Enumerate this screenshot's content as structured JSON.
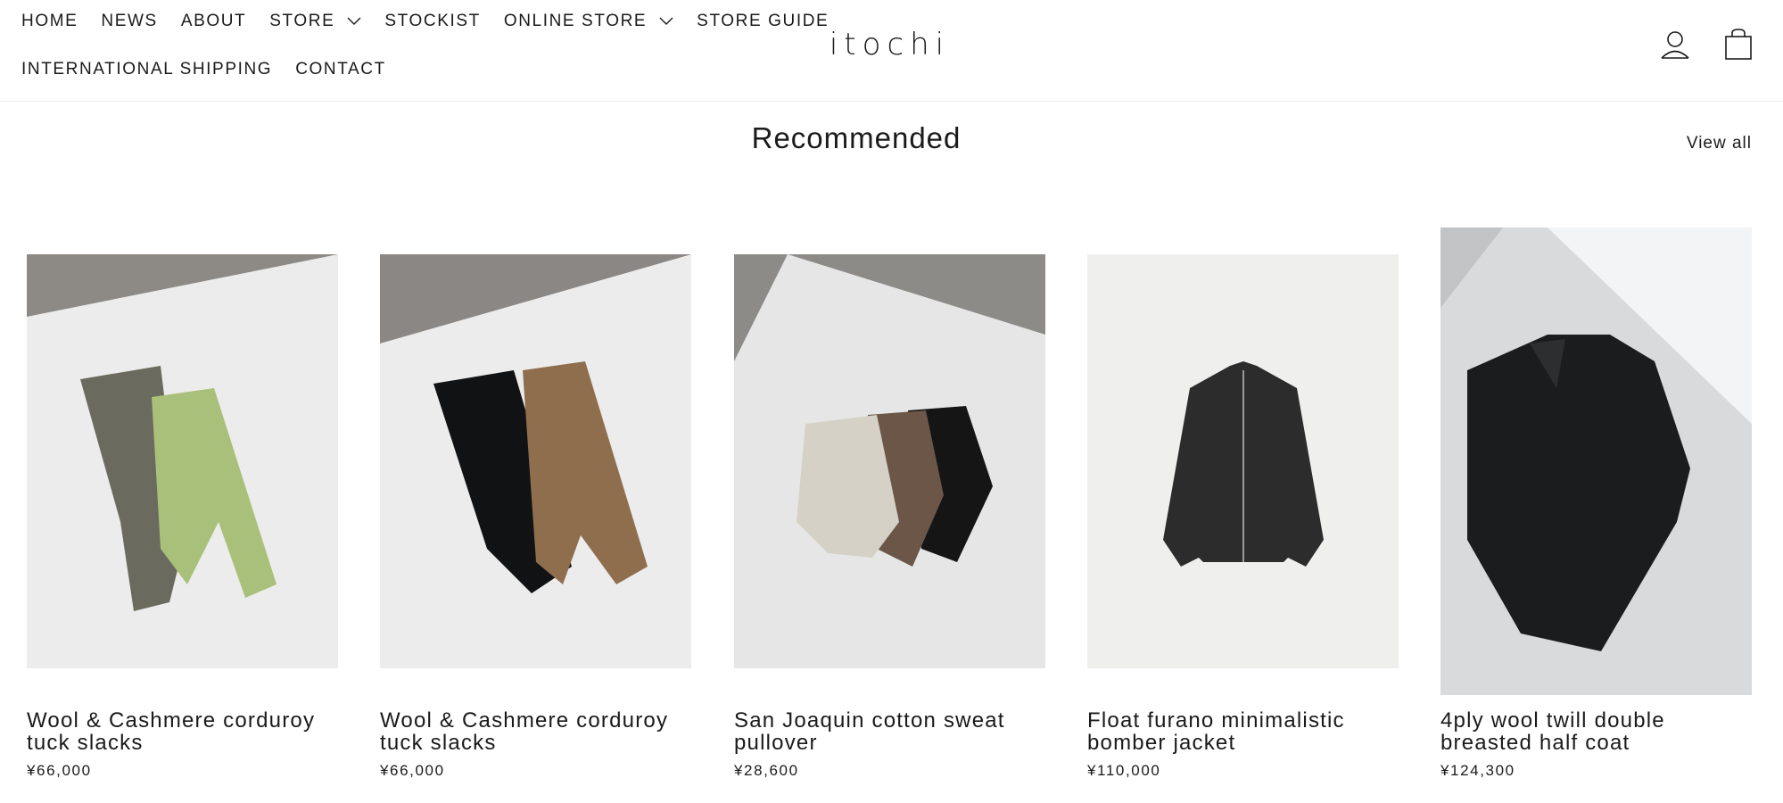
{
  "nav": {
    "row1": [
      {
        "label": "HOME"
      },
      {
        "label": "NEWS"
      },
      {
        "label": "ABOUT"
      },
      {
        "label": "STORE",
        "dropdown": true
      },
      {
        "label": "STOCKIST"
      },
      {
        "label": "ONLINE STORE",
        "dropdown": true
      },
      {
        "label": "STORE GUIDE"
      }
    ],
    "row2": [
      {
        "label": "INTERNATIONAL SHIPPING"
      },
      {
        "label": "CONTACT"
      }
    ]
  },
  "brand": {
    "logo": "itochi"
  },
  "header_icons": [
    "account-icon",
    "cart-bag-icon"
  ],
  "section": {
    "title": "Recommended",
    "view_all": "View all"
  },
  "products": [
    {
      "name": "Wool & Cashmere corduroy tuck slacks",
      "price": "¥66,000",
      "image": "olive and lime corduroy slacks"
    },
    {
      "name": "Wool & Cashmere corduroy tuck slacks",
      "price": "¥66,000",
      "image": "black and brown corduroy slacks"
    },
    {
      "name": "San Joaquin cotton sweat pullover",
      "price": "¥28,600",
      "image": "three sweat pullovers"
    },
    {
      "name": "Float furano minimalistic bomber jacket",
      "price": "¥110,000",
      "image": "dark bomber jacket"
    },
    {
      "name": "4ply wool twill double breasted half coat",
      "price": "¥124,300",
      "image": "black double breasted coat"
    }
  ],
  "colors": {
    "text": "#1a1a1a",
    "background": "#ffffff",
    "divider": "#efefef"
  }
}
